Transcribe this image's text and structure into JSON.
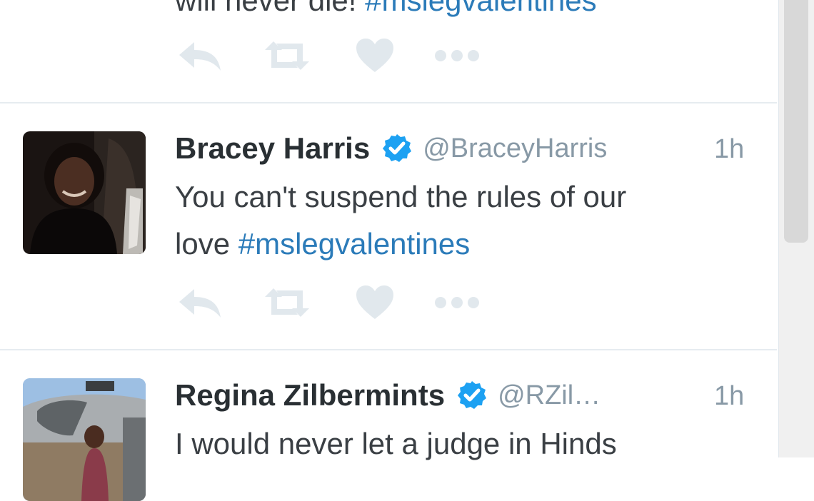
{
  "tweets": [
    {
      "text_tail": "will never die!",
      "hashtag": "#mslegvalentines"
    },
    {
      "name": "Bracey Harris",
      "handle": "@BraceyHarris",
      "time": "1h",
      "text_line1": "You can't suspend the rules of our",
      "text_line2": "love",
      "hashtag": "#mslegvalentines"
    },
    {
      "name": "Regina Zilbermints",
      "handle": "@RZil…",
      "time": "1h",
      "text_line1": "I would never let a judge in Hinds"
    }
  ],
  "actions": [
    "reply-icon",
    "retweet-icon",
    "like-icon",
    "more-icon"
  ],
  "colors": {
    "hashtag": "#2b7bb9",
    "verified": "#1da1f2",
    "meta_text": "#8899a6",
    "action_icon": "#e1e8ed",
    "divider": "#e6ecf0"
  }
}
